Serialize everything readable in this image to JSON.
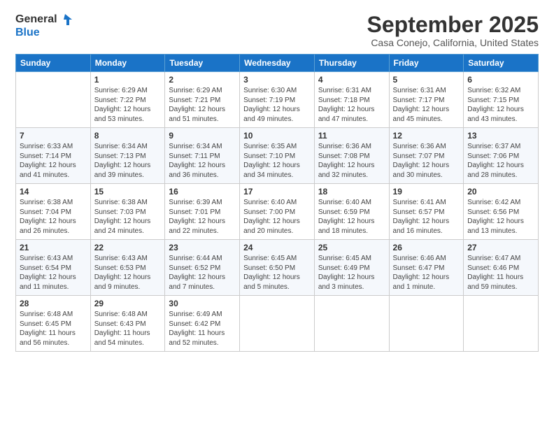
{
  "header": {
    "logo_line1": "General",
    "logo_line2": "Blue",
    "month": "September 2025",
    "location": "Casa Conejo, California, United States"
  },
  "days_of_week": [
    "Sunday",
    "Monday",
    "Tuesday",
    "Wednesday",
    "Thursday",
    "Friday",
    "Saturday"
  ],
  "weeks": [
    [
      {
        "day": "",
        "detail": ""
      },
      {
        "day": "1",
        "detail": "Sunrise: 6:29 AM\nSunset: 7:22 PM\nDaylight: 12 hours\nand 53 minutes."
      },
      {
        "day": "2",
        "detail": "Sunrise: 6:29 AM\nSunset: 7:21 PM\nDaylight: 12 hours\nand 51 minutes."
      },
      {
        "day": "3",
        "detail": "Sunrise: 6:30 AM\nSunset: 7:19 PM\nDaylight: 12 hours\nand 49 minutes."
      },
      {
        "day": "4",
        "detail": "Sunrise: 6:31 AM\nSunset: 7:18 PM\nDaylight: 12 hours\nand 47 minutes."
      },
      {
        "day": "5",
        "detail": "Sunrise: 6:31 AM\nSunset: 7:17 PM\nDaylight: 12 hours\nand 45 minutes."
      },
      {
        "day": "6",
        "detail": "Sunrise: 6:32 AM\nSunset: 7:15 PM\nDaylight: 12 hours\nand 43 minutes."
      }
    ],
    [
      {
        "day": "7",
        "detail": "Sunrise: 6:33 AM\nSunset: 7:14 PM\nDaylight: 12 hours\nand 41 minutes."
      },
      {
        "day": "8",
        "detail": "Sunrise: 6:34 AM\nSunset: 7:13 PM\nDaylight: 12 hours\nand 39 minutes."
      },
      {
        "day": "9",
        "detail": "Sunrise: 6:34 AM\nSunset: 7:11 PM\nDaylight: 12 hours\nand 36 minutes."
      },
      {
        "day": "10",
        "detail": "Sunrise: 6:35 AM\nSunset: 7:10 PM\nDaylight: 12 hours\nand 34 minutes."
      },
      {
        "day": "11",
        "detail": "Sunrise: 6:36 AM\nSunset: 7:08 PM\nDaylight: 12 hours\nand 32 minutes."
      },
      {
        "day": "12",
        "detail": "Sunrise: 6:36 AM\nSunset: 7:07 PM\nDaylight: 12 hours\nand 30 minutes."
      },
      {
        "day": "13",
        "detail": "Sunrise: 6:37 AM\nSunset: 7:06 PM\nDaylight: 12 hours\nand 28 minutes."
      }
    ],
    [
      {
        "day": "14",
        "detail": "Sunrise: 6:38 AM\nSunset: 7:04 PM\nDaylight: 12 hours\nand 26 minutes."
      },
      {
        "day": "15",
        "detail": "Sunrise: 6:38 AM\nSunset: 7:03 PM\nDaylight: 12 hours\nand 24 minutes."
      },
      {
        "day": "16",
        "detail": "Sunrise: 6:39 AM\nSunset: 7:01 PM\nDaylight: 12 hours\nand 22 minutes."
      },
      {
        "day": "17",
        "detail": "Sunrise: 6:40 AM\nSunset: 7:00 PM\nDaylight: 12 hours\nand 20 minutes."
      },
      {
        "day": "18",
        "detail": "Sunrise: 6:40 AM\nSunset: 6:59 PM\nDaylight: 12 hours\nand 18 minutes."
      },
      {
        "day": "19",
        "detail": "Sunrise: 6:41 AM\nSunset: 6:57 PM\nDaylight: 12 hours\nand 16 minutes."
      },
      {
        "day": "20",
        "detail": "Sunrise: 6:42 AM\nSunset: 6:56 PM\nDaylight: 12 hours\nand 13 minutes."
      }
    ],
    [
      {
        "day": "21",
        "detail": "Sunrise: 6:43 AM\nSunset: 6:54 PM\nDaylight: 12 hours\nand 11 minutes."
      },
      {
        "day": "22",
        "detail": "Sunrise: 6:43 AM\nSunset: 6:53 PM\nDaylight: 12 hours\nand 9 minutes."
      },
      {
        "day": "23",
        "detail": "Sunrise: 6:44 AM\nSunset: 6:52 PM\nDaylight: 12 hours\nand 7 minutes."
      },
      {
        "day": "24",
        "detail": "Sunrise: 6:45 AM\nSunset: 6:50 PM\nDaylight: 12 hours\nand 5 minutes."
      },
      {
        "day": "25",
        "detail": "Sunrise: 6:45 AM\nSunset: 6:49 PM\nDaylight: 12 hours\nand 3 minutes."
      },
      {
        "day": "26",
        "detail": "Sunrise: 6:46 AM\nSunset: 6:47 PM\nDaylight: 12 hours\nand 1 minute."
      },
      {
        "day": "27",
        "detail": "Sunrise: 6:47 AM\nSunset: 6:46 PM\nDaylight: 11 hours\nand 59 minutes."
      }
    ],
    [
      {
        "day": "28",
        "detail": "Sunrise: 6:48 AM\nSunset: 6:45 PM\nDaylight: 11 hours\nand 56 minutes."
      },
      {
        "day": "29",
        "detail": "Sunrise: 6:48 AM\nSunset: 6:43 PM\nDaylight: 11 hours\nand 54 minutes."
      },
      {
        "day": "30",
        "detail": "Sunrise: 6:49 AM\nSunset: 6:42 PM\nDaylight: 11 hours\nand 52 minutes."
      },
      {
        "day": "",
        "detail": ""
      },
      {
        "day": "",
        "detail": ""
      },
      {
        "day": "",
        "detail": ""
      },
      {
        "day": "",
        "detail": ""
      }
    ]
  ]
}
